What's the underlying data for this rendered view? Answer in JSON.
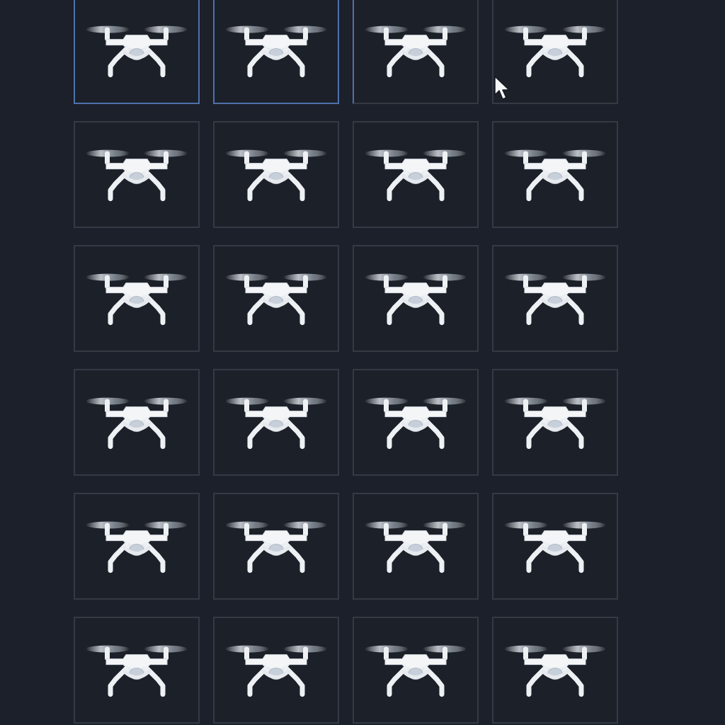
{
  "gallery": {
    "rows": 6,
    "columns": 4,
    "items": [
      {
        "state": "selected"
      },
      {
        "state": "selected"
      },
      {
        "state": "partial"
      },
      {
        "state": "normal"
      },
      {
        "state": "normal"
      },
      {
        "state": "normal"
      },
      {
        "state": "normal"
      },
      {
        "state": "normal"
      },
      {
        "state": "normal"
      },
      {
        "state": "normal"
      },
      {
        "state": "normal"
      },
      {
        "state": "normal"
      },
      {
        "state": "normal"
      },
      {
        "state": "normal"
      },
      {
        "state": "normal"
      },
      {
        "state": "normal"
      },
      {
        "state": "normal"
      },
      {
        "state": "normal"
      },
      {
        "state": "normal"
      },
      {
        "state": "normal"
      },
      {
        "state": "normal"
      },
      {
        "state": "normal"
      },
      {
        "state": "normal"
      },
      {
        "state": "normal"
      }
    ]
  },
  "icons": {
    "tile_icon": "drone-icon",
    "pointer": "mouse-pointer-icon"
  },
  "colors": {
    "background": "#1b202a",
    "tile_background": "#1c2029",
    "tile_border": "#343a44",
    "selected_border": "#4f71ad",
    "drone_body": "#f2f4f6"
  }
}
